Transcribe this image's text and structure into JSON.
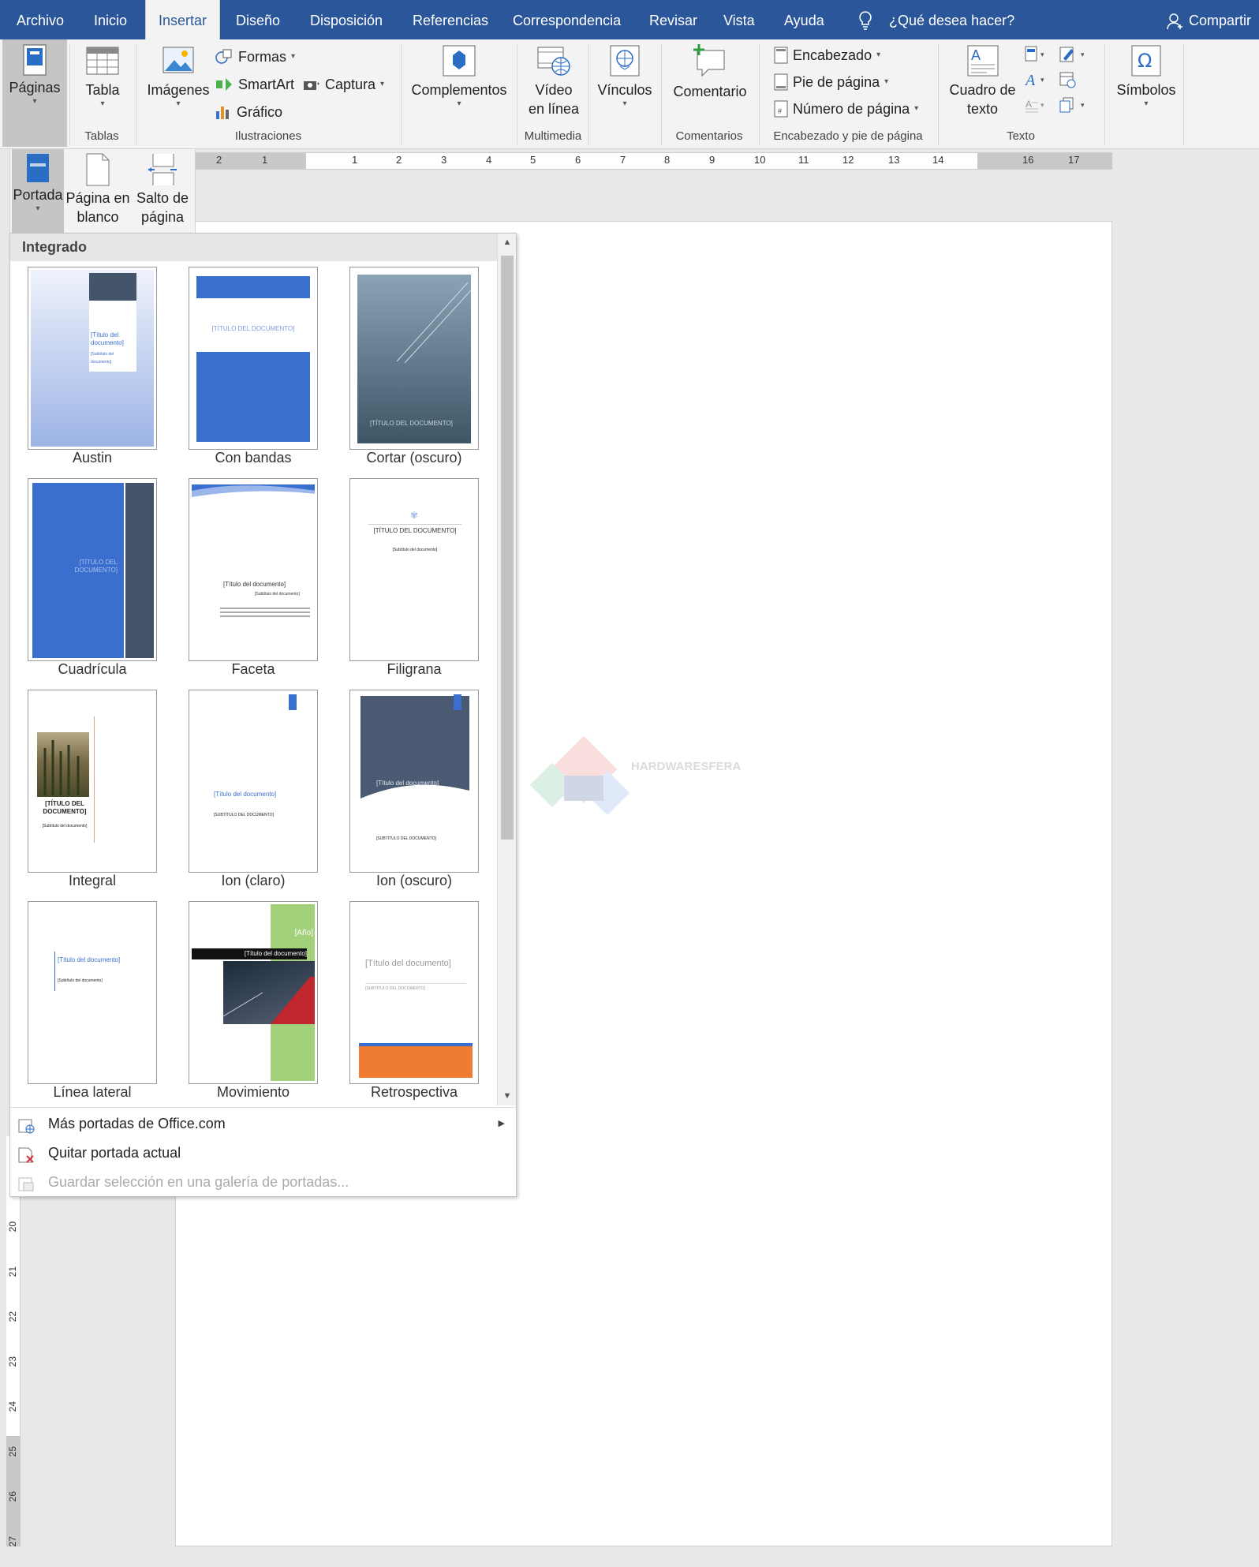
{
  "window": {
    "share_label": "Compartir",
    "tellme": "¿Qué desea hacer?"
  },
  "tabs": [
    {
      "label": "Archivo"
    },
    {
      "label": "Inicio"
    },
    {
      "label": "Insertar"
    },
    {
      "label": "Diseño"
    },
    {
      "label": "Disposición"
    },
    {
      "label": "Referencias"
    },
    {
      "label": "Correspondencia"
    },
    {
      "label": "Revisar"
    },
    {
      "label": "Vista"
    },
    {
      "label": "Ayuda"
    }
  ],
  "ribbon": {
    "paginas": "Páginas",
    "tabla": "Tabla",
    "tablas_group": "Tablas",
    "imagenes": "Imágenes",
    "formas": "Formas",
    "smartart": "SmartArt",
    "captura": "Captura",
    "grafico": "Gráfico",
    "ilustraciones_group": "Ilustraciones",
    "complementos": "Complementos",
    "video1": "Vídeo",
    "video2": "en línea",
    "multimedia_group": "Multimedia",
    "vinculos": "Vínculos",
    "comentario": "Comentario",
    "comentarios_group": "Comentarios",
    "encabezado": "Encabezado",
    "pie": "Pie de página",
    "numero": "Número de página",
    "encabezado_group": "Encabezado y pie de página",
    "cuadro1": "Cuadro de",
    "cuadro2": "texto",
    "texto_group": "Texto",
    "simbolos": "Símbolos"
  },
  "pages_sub": {
    "portada": "Portada",
    "pagina1": "Página en",
    "pagina2": "blanco",
    "salto1": "Salto de",
    "salto2": "página"
  },
  "ruler": {
    "ticks": [
      "2",
      "1",
      "1",
      "2",
      "3",
      "4",
      "5",
      "6",
      "7",
      "8",
      "9",
      "10",
      "11",
      "12",
      "13",
      "14",
      "16",
      "17"
    ],
    "vticks": [
      "20",
      "21",
      "22",
      "23",
      "24",
      "25",
      "26",
      "27"
    ]
  },
  "gallery": {
    "heading": "Integrado",
    "items": [
      {
        "name": "Austin",
        "title": "[Título del documento]",
        "subtitle": "[Subtítulo del documento]"
      },
      {
        "name": "Con bandas",
        "title": "[TÍTULO DEL DOCUMENTO]"
      },
      {
        "name": "Cortar (oscuro)",
        "title": "[TÍTULO DEL DOCUMENTO]"
      },
      {
        "name": "Cuadrícula",
        "title": "[TÍTULO DEL DOCUMENTO]"
      },
      {
        "name": "Faceta",
        "title": "[Título del documento]",
        "subtitle": "[Subtítulo del documento]"
      },
      {
        "name": "Filigrana",
        "title": "[TÍTULO DEL DOCUMENTO]",
        "subtitle": "[Subtítulo del documento]"
      },
      {
        "name": "Integral",
        "title": "[TÍTULO DEL DOCUMENTO]",
        "subtitle": "[Subtítulo del documento]"
      },
      {
        "name": "Ion (claro)",
        "title": "[Título del documento]",
        "subtitle": "[SUBTÍTULO DEL DOCUMENTO]"
      },
      {
        "name": "Ion (oscuro)",
        "title": "[Título del documento]",
        "subtitle": "[SUBTÍTULO DEL DOCUMENTO]"
      },
      {
        "name": "Línea lateral",
        "title": "[Título del documento]",
        "subtitle": "[Subtítulo del documento]"
      },
      {
        "name": "Movimiento",
        "title": "[Título del documento]",
        "year": "[Año]"
      },
      {
        "name": "Retrospectiva",
        "title": "[Título del documento]",
        "subtitle": "[SUBTÍTULO DEL DOCUMENTO]"
      }
    ],
    "menu": [
      {
        "label": "Más portadas de Office.com",
        "enabled": true
      },
      {
        "label": "Quitar portada actual",
        "enabled": true
      },
      {
        "label": "Guardar selección en una galería de portadas...",
        "enabled": false
      }
    ]
  },
  "watermark_text": "HARDWARESFERA",
  "colors": {
    "word_blue": "#2b579a",
    "accent_blue": "#3a6fd0",
    "orange": "#ee7c31",
    "green": "#a3d07a"
  }
}
